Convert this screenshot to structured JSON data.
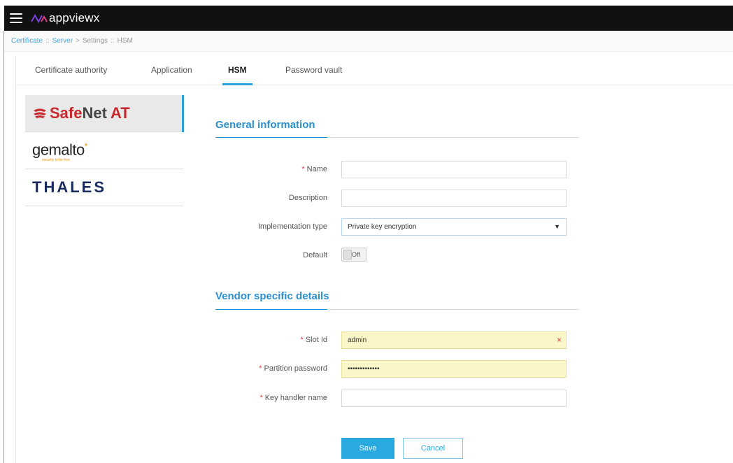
{
  "app": {
    "name": "appviewx"
  },
  "breadcrumb": [
    {
      "label": "Certificate",
      "link": true
    },
    {
      "sep": "::"
    },
    {
      "label": "Server",
      "link": true
    },
    {
      "sep": ">"
    },
    {
      "label": "Settings",
      "link": false
    },
    {
      "sep": "::"
    },
    {
      "label": "HSM",
      "link": false
    }
  ],
  "tabs": [
    {
      "label": "Certificate authority"
    },
    {
      "label": "Application"
    },
    {
      "label": "HSM"
    },
    {
      "label": "Password vault"
    }
  ],
  "vendors": {
    "safenet": {
      "part1": "Safe",
      "part2": "Net",
      "part3": "AT"
    },
    "gemalto": {
      "name": "gemalto",
      "tagline": "security to be free"
    },
    "thales": {
      "name": "THALES"
    }
  },
  "general": {
    "title": "General information",
    "name_label": "Name",
    "name_value": "",
    "description_label": "Description",
    "description_value": "",
    "impl_label": "Implementation type",
    "impl_value": "Private key encryption",
    "default_label": "Default",
    "default_value": "Off"
  },
  "vendor_details": {
    "title": "Vendor specific details",
    "slot_label": "Slot Id",
    "slot_value": "admin",
    "partition_label": "Partition password",
    "partition_value": "•••••••••••••",
    "key_label": "Key handler name",
    "key_value": ""
  },
  "actions": {
    "save": "Save",
    "cancel": "Cancel"
  },
  "colors": {
    "accent": "#2b9fd8",
    "warn_bg": "#fbf6c7",
    "required": "#e53935"
  }
}
